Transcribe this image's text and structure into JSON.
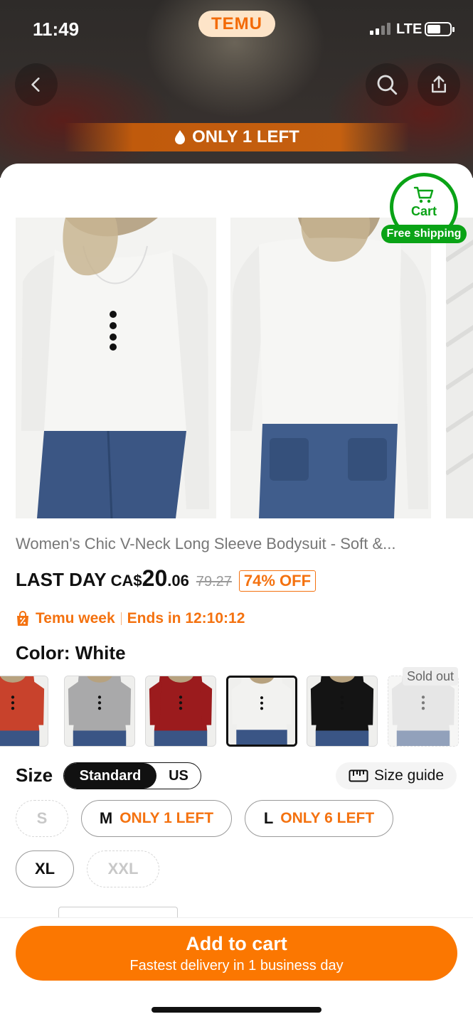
{
  "status_bar": {
    "time": "11:49",
    "network": "LTE"
  },
  "header": {
    "logo": "TEMU",
    "stock_banner": "ONLY 1 LEFT"
  },
  "cart_badge": {
    "label": "Cart",
    "shipping": "Free shipping"
  },
  "product": {
    "title": "Women's Chic V-Neck Long Sleeve Bodysuit - Soft &...",
    "price_prefix": "LAST DAY",
    "currency": "CA$",
    "price_int": "20",
    "price_dec": ".06",
    "original_price": "79.27",
    "discount": "74% OFF"
  },
  "promo": {
    "label": "Temu week",
    "ends": "Ends in 12:10:12"
  },
  "color": {
    "heading": "Color: White",
    "sold_out_label": "Sold out",
    "swatches": [
      {
        "name": "Orange-red",
        "hex": "#c8422c"
      },
      {
        "name": "Grey",
        "hex": "#a9a9aa"
      },
      {
        "name": "Burgundy",
        "hex": "#9b1b1d"
      },
      {
        "name": "White",
        "hex": "#f2f2f0",
        "selected": true
      },
      {
        "name": "Black",
        "hex": "#141414"
      },
      {
        "name": "Light grey",
        "hex": "#d2d2d2",
        "sold_out": true
      }
    ]
  },
  "size": {
    "heading": "Size",
    "toggle_standard": "Standard",
    "toggle_us": "US",
    "guide": "Size guide",
    "options": {
      "s": "S",
      "m": "M",
      "m_stock": "ONLY 1 LEFT",
      "l": "L",
      "l_stock": "ONLY 6 LEFT",
      "xl": "XL",
      "xxl": "XXL"
    }
  },
  "cta": {
    "label": "Add to cart",
    "sub": "Fastest delivery in 1 business day"
  },
  "colors": {
    "brand_orange": "#fb7701",
    "accent_green": "#0aa316",
    "warn_orange": "#f47210"
  }
}
